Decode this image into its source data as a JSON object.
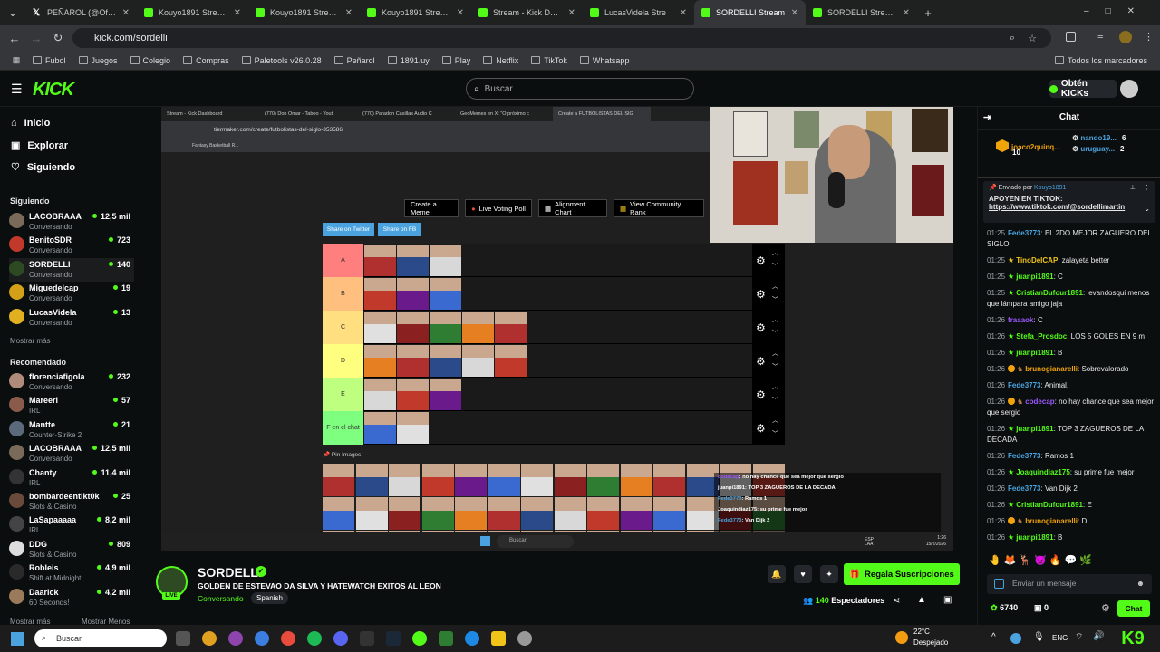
{
  "browser": {
    "tabs": [
      {
        "title": "PEÑAROL (@OficialCAP",
        "icon": "x-icon",
        "active": false
      },
      {
        "title": "Kouyo1891 Stream -",
        "icon": "kick-icon",
        "active": false
      },
      {
        "title": "Kouyo1891 Stream -",
        "icon": "kick-icon",
        "active": false
      },
      {
        "title": "Kouyo1891 Stream -",
        "icon": "kick-icon",
        "active": false
      },
      {
        "title": "Stream - Kick Dashbo",
        "icon": "kick-icon",
        "active": false
      },
      {
        "title": "LucasVidela Stre",
        "icon": "kick-icon",
        "active": false
      },
      {
        "title": "SORDELLI Stream",
        "icon": "kick-icon",
        "active": true
      },
      {
        "title": "SORDELLI Stream - K",
        "icon": "kick-icon",
        "active": false
      }
    ],
    "url": "kick.com/sordelli",
    "bookmarks": [
      "Fubol",
      "Juegos",
      "Colegio",
      "Compras",
      "Paletools v26.0.28",
      "Peñarol",
      "1891.uy",
      "Play",
      "Netflix",
      "TikTok",
      "Whatsapp"
    ],
    "all_bookmarks": "Todos los marcadores"
  },
  "header": {
    "logo": "KICK",
    "search_placeholder": "Buscar",
    "get_kicks": "Obtén KICKs"
  },
  "sidebar": {
    "nav": [
      "Inicio",
      "Explorar",
      "Siguiendo"
    ],
    "following_title": "Siguiendo",
    "following": [
      {
        "name": "LACOBRAAA",
        "category": "Conversando",
        "viewers": "12,5 mil",
        "color": "#7a6a5a"
      },
      {
        "name": "BenitoSDR",
        "category": "Conversando",
        "viewers": "723",
        "color": "#c0392b"
      },
      {
        "name": "SORDELLI",
        "category": "Conversando",
        "viewers": "140",
        "color": "#2d4a22"
      },
      {
        "name": "Miguedelcap",
        "category": "Conversando",
        "viewers": "19",
        "color": "#d4a017"
      },
      {
        "name": "LucasVidela",
        "category": "Conversando",
        "viewers": "13",
        "color": "#e0b020"
      }
    ],
    "show_more": "Mostrar más",
    "recommended_title": "Recomendado",
    "recommended": [
      {
        "name": "florenciafigola",
        "category": "Conversando",
        "viewers": "232",
        "color": "#b08a7a"
      },
      {
        "name": "Mareerl",
        "category": "IRL",
        "viewers": "57",
        "color": "#8a5a4a"
      },
      {
        "name": "Mantte",
        "category": "Counter-Strike 2",
        "viewers": "21",
        "color": "#5a6a7a"
      },
      {
        "name": "LACOBRAAA",
        "category": "Conversando",
        "viewers": "12,5 mil",
        "color": "#7a6a5a"
      },
      {
        "name": "Chanty",
        "category": "IRL",
        "viewers": "11,4 mil",
        "color": "#333"
      },
      {
        "name": "bombardeentikt0k",
        "category": "Slots & Casino",
        "viewers": "25",
        "color": "#6a4a3a"
      },
      {
        "name": "LaSapaaaaa",
        "category": "IRL",
        "viewers": "8,2 mil",
        "color": "#444"
      },
      {
        "name": "DDG",
        "category": "Slots & Casino",
        "viewers": "809",
        "color": "#ddd"
      },
      {
        "name": "Robleis",
        "category": "Shift at Midnight",
        "viewers": "4,9 mil",
        "color": "#2a2a2a"
      },
      {
        "name": "Daarick",
        "category": "60 Seconds!",
        "viewers": "4,2 mil",
        "color": "#9a7a5a"
      }
    ],
    "show_more_2": "Mostrar más",
    "show_less": "Mostrar Menos"
  },
  "video": {
    "inner_tabs": [
      "Stream - Kick Dashboard",
      "(770) Don Omar - Taboo - Yout",
      "(770) Paradon Casillas Audio C",
      "GeoMemes en X: \"O próximo c",
      "Create a FUTBOLISTAS DEL SIG"
    ],
    "inner_url": "tiermaker.com/create/futbolistas-del-siglo-353586",
    "inner_bookmark": "Fantasy Basketball R...",
    "buttons": [
      "Create a Meme",
      "Live Voting Poll",
      "Alignment Chart",
      "View Community Rank"
    ],
    "share": [
      "Share on Twitter",
      "Share on FB"
    ],
    "tiers": [
      {
        "label": "A",
        "color": "#ff7f7f",
        "count": 3
      },
      {
        "label": "B",
        "color": "#ffbf7f",
        "count": 3
      },
      {
        "label": "C",
        "color": "#ffdf7f",
        "count": 5
      },
      {
        "label": "D",
        "color": "#ffff7f",
        "count": 5
      },
      {
        "label": "E",
        "color": "#bfff7f",
        "count": 3
      },
      {
        "label": "F en el chat",
        "color": "#7fff7f",
        "count": 2
      }
    ],
    "pin_label": "Pin Images",
    "overlay_chat": [
      {
        "user": "codecap",
        "text": ": no hay chance que sea mejor que sergio",
        "color": "#9b59ff"
      },
      {
        "user": "juanpi1891",
        "text": ": TOP 3 ZAGUEROS DE LA DECADA",
        "color": "#fff"
      },
      {
        "user": "Fede3773",
        "text": ": Ramos 1",
        "color": "#4aa3df"
      },
      {
        "user": "Joaquindiaz175",
        "text": ": su prime fue mejor",
        "color": "#fff"
      },
      {
        "user": "Fede3773",
        "text": ": Van Dijk 2",
        "color": "#4aa3df"
      }
    ],
    "inner_search": "Buscar",
    "inner_lang": "ESP LAA",
    "inner_time": "1:26",
    "inner_date": "15/2/2026"
  },
  "stream": {
    "name": "SORDELLI",
    "title": "GOLDEN DE ESTEVAO DA SILVA Y HATEWATCH EXITOS AL LEON",
    "category": "Conversando",
    "language": "Spanish",
    "live": "LIVE",
    "subscribe": "Regala Suscripciones",
    "viewers_count": "140",
    "viewers_label": "Espectadores"
  },
  "chat": {
    "title": "Chat",
    "top_gifters": [
      {
        "name": "joaco2quinq...",
        "count": "10"
      },
      {
        "name": "nando19...",
        "count": "6"
      },
      {
        "name": "uruguay...",
        "count": "2"
      }
    ],
    "pinned_by_label": "Enviado por",
    "pinned_by_user": "Kouyo1891",
    "pinned_line1": "APOYEN EN TIKTOK:",
    "pinned_link": "https://www.tiktok.com/@sordellimartin",
    "messages": [
      {
        "time": "01:25",
        "user": "Fede3773",
        "text": ": EL 2DO MEJOR ZAGUERO DEL SIGLO.",
        "color": "#4aa3df",
        "badge": "none"
      },
      {
        "time": "01:25",
        "user": "TinoDelCAP",
        "text": ": zalayeta better",
        "color": "#f0c419",
        "badge": "star-gold"
      },
      {
        "time": "01:25",
        "user": "juanpi1891",
        "text": ": C",
        "color": "#53fc18",
        "badge": "star"
      },
      {
        "time": "01:25",
        "user": "CristianDufour1891",
        "text": ": levandosqui menos que lámpara amigo jaja",
        "color": "#53fc18",
        "badge": "star"
      },
      {
        "time": "01:26",
        "user": "fraaaok",
        "text": ": C",
        "color": "#9b59ff",
        "badge": "none"
      },
      {
        "time": "01:26",
        "user": "Stefa_Prosdoc",
        "text": ": LOS 5 GOLES EN 9 m",
        "color": "#53fc18",
        "badge": "star"
      },
      {
        "time": "01:26",
        "user": "juanpi1891",
        "text": ": B",
        "color": "#53fc18",
        "badge": "star"
      },
      {
        "time": "01:26",
        "user": "brunogianarelli",
        "text": ": Sobrevalorado",
        "color": "#f0a30a",
        "badge": "coin"
      },
      {
        "time": "01:26",
        "user": "Fede3773",
        "text": ": Animal.",
        "color": "#4aa3df",
        "badge": "none"
      },
      {
        "time": "01:26",
        "user": "codecap",
        "text": ": no hay chance que sea mejor que sergio",
        "color": "#9b59ff",
        "badge": "coin"
      },
      {
        "time": "01:26",
        "user": "juanpi1891",
        "text": ": TOP 3 ZAGUEROS DE LA DECADA",
        "color": "#53fc18",
        "badge": "star"
      },
      {
        "time": "01:26",
        "user": "Fede3773",
        "text": ": Ramos 1",
        "color": "#4aa3df",
        "badge": "none"
      },
      {
        "time": "01:26",
        "user": "Joaquindiaz175",
        "text": ": su prime fue mejor",
        "color": "#53fc18",
        "badge": "star"
      },
      {
        "time": "01:26",
        "user": "Fede3773",
        "text": ": Van Dijk 2",
        "color": "#4aa3df",
        "badge": "none"
      },
      {
        "time": "01:26",
        "user": "CristianDufour1891",
        "text": ": E",
        "color": "#53fc18",
        "badge": "star"
      },
      {
        "time": "01:26",
        "user": "brunogianarelli",
        "text": ": D",
        "color": "#f0a30a",
        "badge": "coin"
      },
      {
        "time": "01:26",
        "user": "juanpi1891",
        "text": ": B",
        "color": "#53fc18",
        "badge": "star"
      }
    ],
    "input_placeholder": "Enviar un mensaje",
    "points": "6740",
    "zero": "0",
    "send": "Chat"
  },
  "taskbar": {
    "search": "Buscar",
    "temp": "22°C",
    "weather": "Despejado",
    "lang": "ENG"
  }
}
